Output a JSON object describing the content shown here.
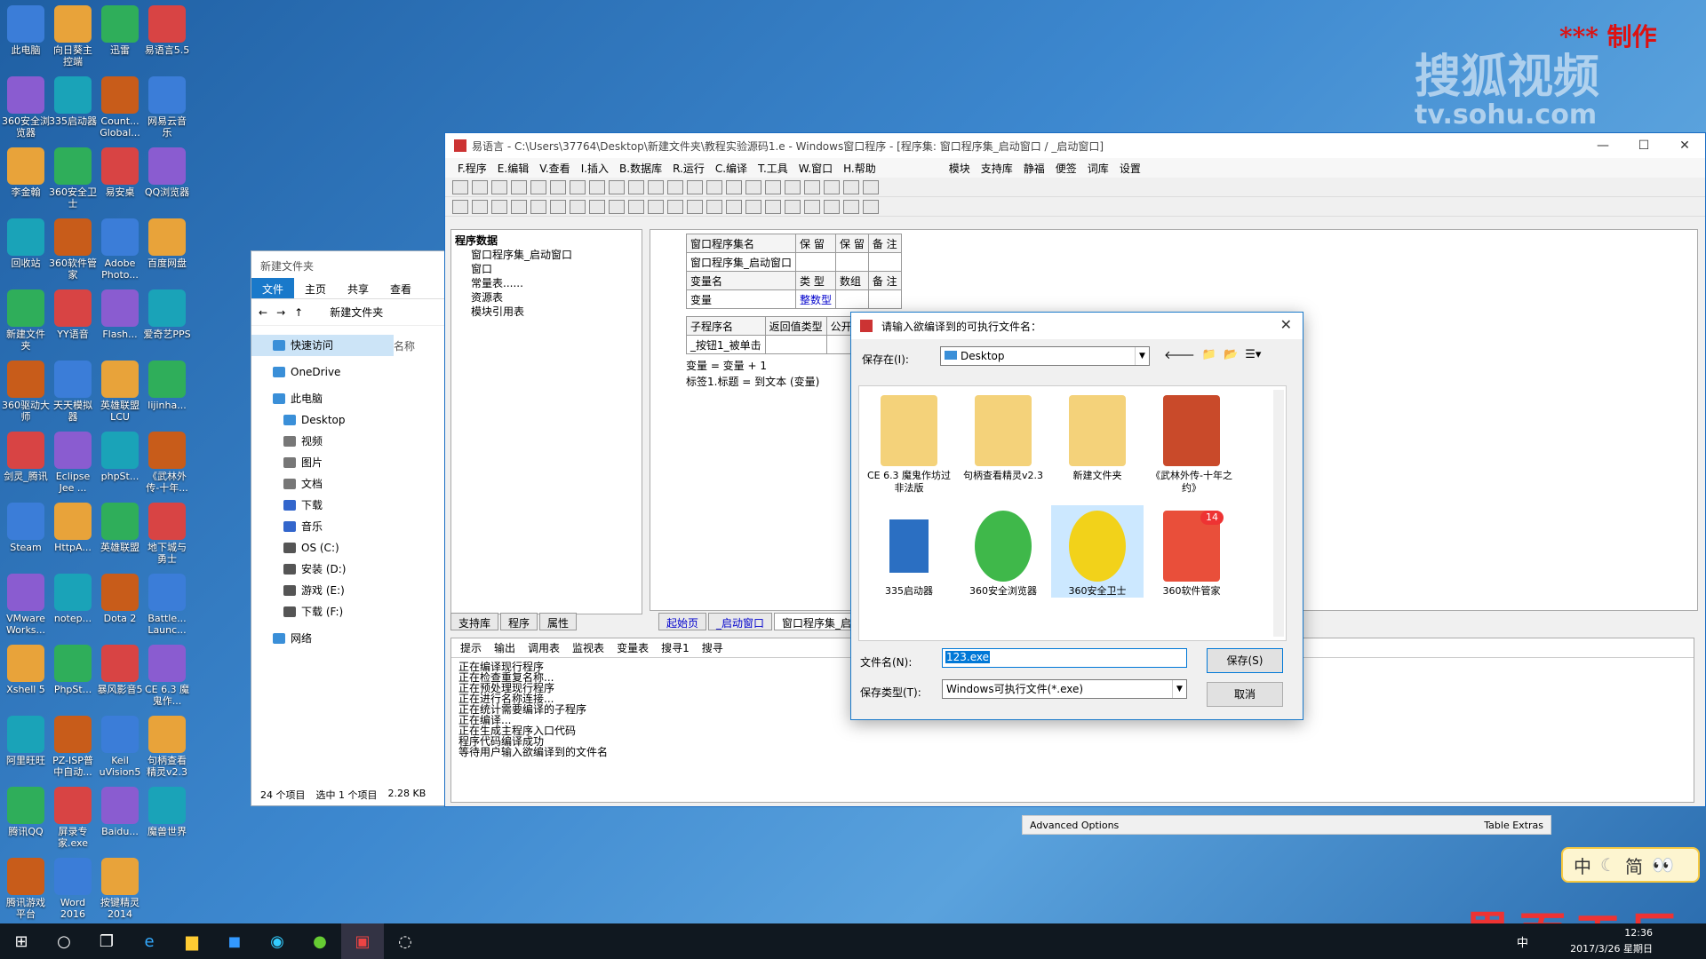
{
  "watermark": {
    "site_cn": "搜狐视频",
    "site_url": "tv.sohu.com",
    "maker": "*** 制作",
    "bottom_logo": "界面工厂"
  },
  "desktop_icons": [
    [
      "此电脑",
      "向日葵主控端",
      "迅雷",
      "易语言5.5"
    ],
    [
      "360安全浏览器",
      "335启动器",
      "Count... Global...",
      "网易云音乐"
    ],
    [
      "李金翰",
      "360安全卫士",
      "易安桌",
      "QQ浏览器"
    ],
    [
      "回收站",
      "360软件管家",
      "Adobe Photo...",
      "百度网盘"
    ],
    [
      "新建文件夹",
      "YY语音",
      "Flash...",
      "爱奇艺PPS"
    ],
    [
      "360驱动大师",
      "天天模拟器",
      "英雄联盟LCU",
      "lijinha..."
    ],
    [
      "剑灵_腾讯",
      "Eclipse Jee ...",
      "phpSt...",
      "《武林外传-十年..."
    ],
    [
      "Steam",
      "HttpA...",
      "英雄联盟",
      "地下城与勇士"
    ],
    [
      "VMware Works...",
      "notep...",
      "Dota 2",
      "Battle... Launc..."
    ],
    [
      "Xshell 5",
      "PhpSt...",
      "暴风影音5",
      "CE 6.3 魔鬼作..."
    ],
    [
      "阿里旺旺",
      "PZ-ISP普中自动...",
      "Keil uVision5",
      "句柄查看精灵v2.3"
    ],
    [
      "腾讯QQ",
      "屏录专家.exe",
      "Baidu...",
      "魔兽世界"
    ],
    [
      "腾讯游戏平台",
      "Word 2016",
      "按键精灵2014"
    ]
  ],
  "explorer": {
    "title": "新建文件夹",
    "ribbon": [
      "文件",
      "主页",
      "共享",
      "查看"
    ],
    "path": "新建文件夹",
    "nav": [
      "快速访问",
      "OneDrive",
      "此电脑",
      "Desktop",
      "视频",
      "图片",
      "文档",
      "下载",
      "音乐",
      "OS (C:)",
      "安装 (D:)",
      "游戏 (E:)",
      "下载 (F:)",
      "网络"
    ],
    "col_header": "名称",
    "status": {
      "count": "24 个项目",
      "selected": "选中 1 个项目",
      "size": "2.28 KB"
    }
  },
  "ide": {
    "title": "易语言 - C:\\Users\\37764\\Desktop\\新建文件夹\\教程实验源码1.e - Windows窗口程序 - [程序集: 窗口程序集_启动窗口 / _启动窗口]",
    "menu": [
      "F.程序",
      "E.编辑",
      "V.查看",
      "I.插入",
      "B.数据库",
      "R.运行",
      "C.编译",
      "T.工具",
      "W.窗口",
      "H.帮助",
      "模块",
      "支持库",
      "静福",
      "便签",
      "词库",
      "设置"
    ],
    "tree": [
      "程序数据",
      "窗口程序集_启动窗口",
      "窗口",
      "常量表......",
      "资源表",
      "模块引用表"
    ],
    "grid1_header": [
      "窗口程序集名",
      "保 留",
      "保 留",
      "备 注"
    ],
    "grid1_row": [
      "窗口程序集_启动窗口",
      "",
      "",
      ""
    ],
    "grid2_header": [
      "变量名",
      "类 型",
      "数组",
      "备 注"
    ],
    "grid2_row": [
      "变量",
      "整数型",
      "",
      ""
    ],
    "grid3_header": [
      "子程序名",
      "返回值类型",
      "公开"
    ],
    "grid3_row": [
      "_按钮1_被单击",
      "",
      ""
    ],
    "code1": "变量 = 变量 + 1",
    "code2": "标签1.标题 = 到文本 (变量)",
    "left_tabs": [
      "支持库",
      "程序",
      "属性"
    ],
    "editor_tabs": [
      "起始页",
      "_启动窗口",
      "窗口程序集_启动..."
    ],
    "output_tabs": [
      "提示",
      "输出",
      "调用表",
      "监视表",
      "变量表",
      "搜寻1",
      "搜寻"
    ],
    "output_log": [
      "正在编译现行程序",
      "正在检查重复名称...",
      "正在预处理现行程序",
      "正在进行名称连接...",
      "正在统计需要编译的子程序",
      "正在编译...",
      "正在生成主程序入口代码",
      "程序代码编译成功",
      "等待用户输入欲编译到的文件名"
    ]
  },
  "dialog": {
    "title": "请输入欲编译到的可执行文件名：",
    "save_in_label": "保存在(I):",
    "save_in_value": "Desktop",
    "files": [
      "CE 6.3 魔鬼作坊过非法版",
      "句柄查看精灵v2.3",
      "新建文件夹",
      "《武林外传-十年之约》",
      "335启动器",
      "360安全浏览器",
      "360安全卫士",
      "360软件管家"
    ],
    "badge": "14",
    "filename_label": "文件名(N):",
    "filename_value": "123.exe",
    "type_label": "保存类型(T):",
    "type_value": "Windows可执行文件(*.exe)",
    "save_btn": "保存(S)",
    "cancel_btn": "取消"
  },
  "advanced": {
    "left": "Advanced Options",
    "right": "Table Extras"
  },
  "ime": {
    "mode": "中",
    "simp": "简"
  },
  "taskbar": {
    "time": "12:36",
    "date": "2017/3/26 星期日",
    "lang": "中"
  }
}
